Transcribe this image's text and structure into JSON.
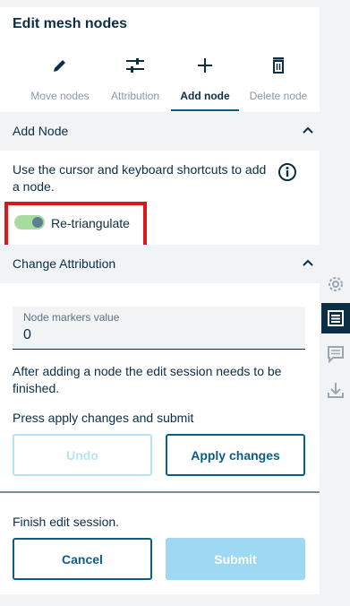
{
  "header": {
    "title": "Edit mesh nodes"
  },
  "tabs": [
    {
      "label": "Move nodes",
      "icon": "pencil-icon"
    },
    {
      "label": "Attribution",
      "icon": "sliders-icon"
    },
    {
      "label": "Add node",
      "icon": "plus-icon",
      "active": true
    },
    {
      "label": "Delete node",
      "icon": "trash-icon"
    }
  ],
  "add_node": {
    "heading": "Add Node",
    "instruction_line1": "Use the cursor and keyboard shortcuts to add",
    "instruction_line2": "a node.",
    "toggle_label": "Re-triangulate",
    "toggle_on": true
  },
  "change_attribution": {
    "heading": "Change Attribution",
    "field_label": "Node markers value",
    "field_value": "0",
    "note_line1": "After adding a node the edit session needs to be",
    "note_line2": "finished.",
    "prompt": "Press apply changes and submit",
    "undo_label": "Undo",
    "apply_label": "Apply changes"
  },
  "finish": {
    "text": "Finish edit session.",
    "cancel_label": "Cancel",
    "submit_label": "Submit"
  },
  "colors": {
    "accent": "#0b5d87",
    "text": "#0b2e45",
    "toggle_track": "#a8dba0",
    "highlight": "#d61a1a"
  }
}
